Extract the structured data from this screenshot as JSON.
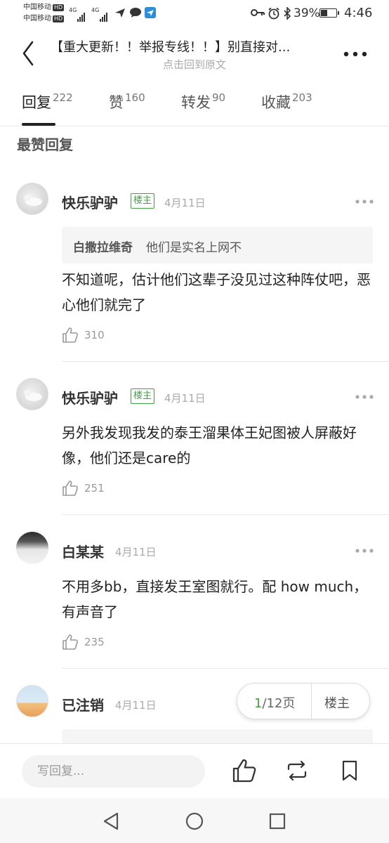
{
  "status_bar": {
    "carrier1": "中国移动",
    "carrier2": "中国移动",
    "hd": "HD",
    "network1": "4G",
    "network2": "4G",
    "battery_percent": "39%",
    "battery_level": 0.39,
    "time": "4:46",
    "icons": [
      "key-icon",
      "alarm-icon",
      "bluetooth-icon",
      "send-icon",
      "chat-icon",
      "app-icon"
    ]
  },
  "header": {
    "title": "【重大更新！！举报专线！！】别直接对...",
    "subtitle": "点击回到原文"
  },
  "tabs": [
    {
      "label": "回复",
      "count": "222",
      "active": true
    },
    {
      "label": "赞",
      "count": "160"
    },
    {
      "label": "转发",
      "count": "90"
    },
    {
      "label": "收藏",
      "count": "203"
    }
  ],
  "section_title": "最赞回复",
  "comments": [
    {
      "user": "快乐驴驴",
      "badge": "楼主",
      "date": "4月11日",
      "quote_user": "白撒拉维奇",
      "quote_text": "他们是实名上网不",
      "text": "不知道呢，估计他们这辈子没见过这种阵仗吧，恶心他们就完了",
      "likes": "310"
    },
    {
      "user": "快乐驴驴",
      "badge": "楼主",
      "date": "4月11日",
      "text": "另外我发现我发的泰王溜果体王妃图被人屏蔽好像，他们还是care的",
      "likes": "251"
    },
    {
      "user": "白某某",
      "date": "4月11日",
      "text": "不用多bb，直接发王室图就行。配 how much，有声音了",
      "likes": "235"
    },
    {
      "user": "已注销",
      "date": "4月11日"
    }
  ],
  "pager": {
    "current": "1",
    "total": "/12页",
    "op_label": "楼主"
  },
  "bottom_bar": {
    "reply_placeholder": "写回复..."
  },
  "colors": {
    "accent_green": "#43a047",
    "text_primary": "#222222",
    "text_muted": "#aaaaaa"
  }
}
